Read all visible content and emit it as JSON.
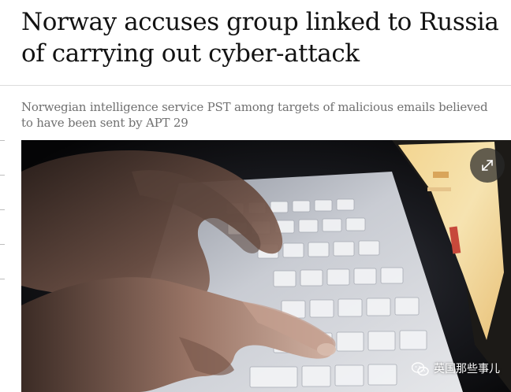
{
  "article": {
    "headline": "Norway accuses group linked to Russia of carrying out cyber-attack",
    "standfirst": "Norwegian intelligence service PST among targets of malicious emails believed to have been sent by APT 29"
  },
  "image": {
    "expand_icon": "expand-arrows-icon",
    "watermark_text": "英国那些事儿",
    "watermark_icon": "wechat-icon"
  },
  "colors": {
    "headline": "#121212",
    "standfirst": "#707070",
    "expand_button_bg": "#282828"
  }
}
